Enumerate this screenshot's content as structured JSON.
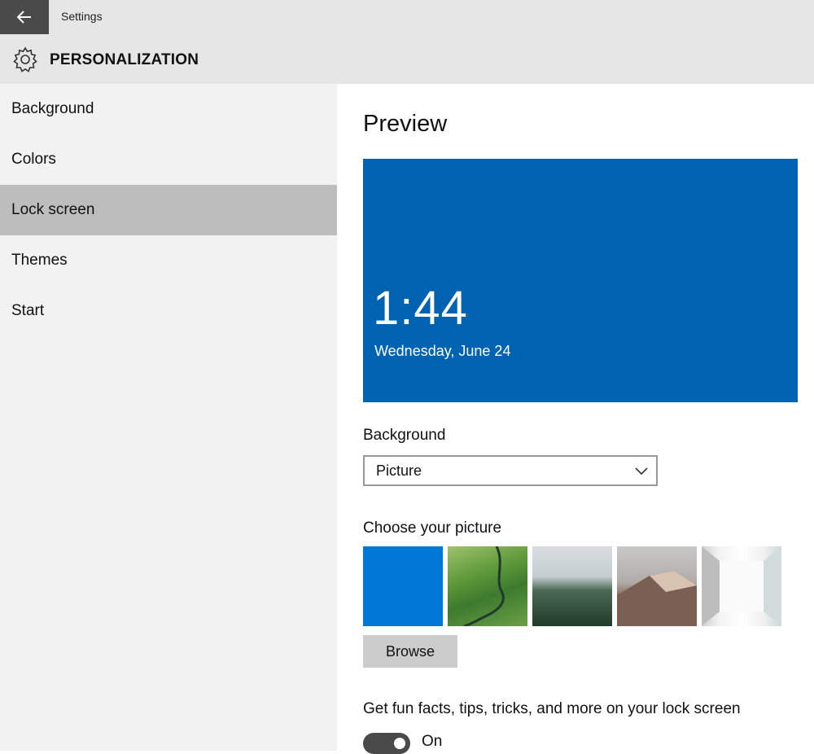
{
  "window": {
    "title": "Settings"
  },
  "header": {
    "section": "PERSONALIZATION",
    "icon": "gear-icon"
  },
  "sidebar": {
    "items": [
      {
        "label": "Background",
        "selected": false
      },
      {
        "label": "Colors",
        "selected": false
      },
      {
        "label": "Lock screen",
        "selected": true
      },
      {
        "label": "Themes",
        "selected": false
      },
      {
        "label": "Start",
        "selected": false
      }
    ]
  },
  "main": {
    "preview": {
      "title": "Preview",
      "time": "1:44",
      "date": "Wednesday, June 24",
      "color": "#0063b1"
    },
    "background": {
      "label": "Background",
      "selected_value": "Picture"
    },
    "pictures": {
      "label": "Choose your picture",
      "thumbnail_count": 5
    },
    "browse_label": "Browse",
    "fun_facts": {
      "label": "Get fun facts, tips, tricks, and more on your lock screen",
      "toggle_state": "On"
    }
  },
  "colors": {
    "accent": "#0078d7",
    "sidebar_selected": "#bdbdbd"
  }
}
